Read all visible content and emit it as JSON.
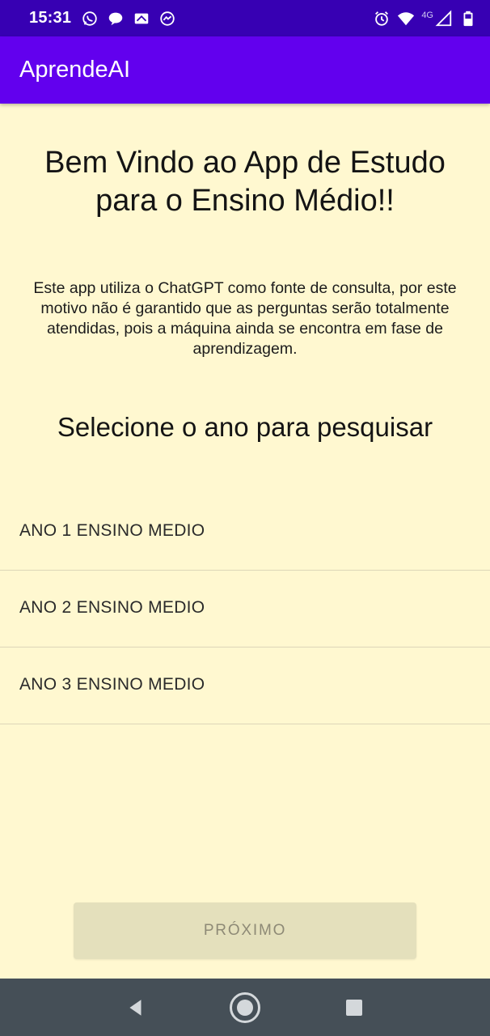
{
  "status_bar": {
    "time": "15:31",
    "left_icons": [
      "whatsapp-icon",
      "chat-bubble-icon",
      "news-icon",
      "messenger-icon"
    ],
    "network_label": "4G",
    "right_icons": [
      "alarm-icon",
      "wifi-icon",
      "signal-icon",
      "battery-icon"
    ]
  },
  "app_bar": {
    "title": "AprendeAI",
    "background": "#6200ee"
  },
  "main": {
    "welcome_title": "Bem Vindo ao App de Estudo para o Ensino Médio!!",
    "disclaimer": "Este app utiliza o ChatGPT como fonte de consulta, por este motivo não é garantido que as perguntas serão totalmente atendidas, pois a máquina ainda se encontra em fase de aprendizagem.",
    "select_heading": "Selecione o ano para pesquisar",
    "years": [
      {
        "label": "ANO 1 ENSINO MEDIO"
      },
      {
        "label": "ANO 2 ENSINO MEDIO"
      },
      {
        "label": "ANO 3 ENSINO MEDIO"
      }
    ],
    "next_button_label": "PRÓXIMO",
    "background": "#fff8d0"
  },
  "nav_bar": {
    "buttons": [
      "back-icon",
      "home-icon",
      "recents-icon"
    ]
  }
}
